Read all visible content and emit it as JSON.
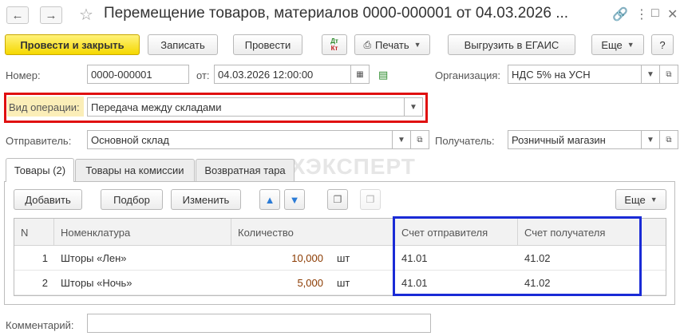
{
  "window": {
    "title": "Перемещение товаров, материалов 0000-000001 от 04.03.2026 ...",
    "back_icon": "arrow-left-icon",
    "forward_icon": "arrow-right-icon"
  },
  "toolbar": {
    "post_close_label": "Провести и закрыть",
    "save_label": "Записать",
    "post_label": "Провести",
    "dtkt_top": "Дт",
    "dtkt_bottom": "Кт",
    "print_label": "Печать",
    "egais_label": "Выгрузить в ЕГАИС",
    "more_label": "Еще",
    "help_label": "?"
  },
  "form": {
    "number_label": "Номер:",
    "number_value": "0000-000001",
    "date_label": "от:",
    "date_value": "04.03.2026 12:00:00",
    "org_label": "Организация:",
    "org_value": "НДС 5% на УСН",
    "op_label": "Вид операции:",
    "op_value": "Передача между складами",
    "sender_label": "Отправитель:",
    "sender_value": "Основной склад",
    "receiver_label": "Получатель:",
    "receiver_value": "Розничный магазин",
    "comment_label": "Комментарий:",
    "comment_value": ""
  },
  "tabs": [
    {
      "label": "Товары (2)",
      "active": true
    },
    {
      "label": "Товары на комиссии",
      "active": false
    },
    {
      "label": "Возвратная тара",
      "active": false
    }
  ],
  "watermark": "БУХЭКСПЕРТ",
  "table_toolbar": {
    "add_label": "Добавить",
    "pick_label": "Подбор",
    "edit_label": "Изменить",
    "more_label": "Еще"
  },
  "table": {
    "columns": [
      "N",
      "Номенклатура",
      "Количество",
      "Счет отправителя",
      "Счет получателя"
    ],
    "rows": [
      {
        "n": "1",
        "name": "Шторы «Лен»",
        "qty": "10,000",
        "unit": "шт",
        "acc_from": "41.01",
        "acc_to": "41.02"
      },
      {
        "n": "2",
        "name": "Шторы «Ночь»",
        "qty": "5,000",
        "unit": "шт",
        "acc_from": "41.01",
        "acc_to": "41.02"
      }
    ]
  },
  "colors": {
    "primary_button": "#f5d800",
    "highlight_red": "#e01010",
    "highlight_blue": "#1a2bd6",
    "qty_highlight": "#8b3a00"
  }
}
